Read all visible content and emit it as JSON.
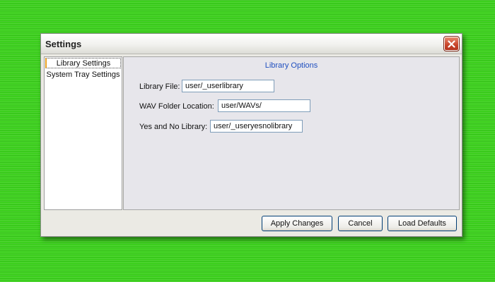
{
  "window": {
    "title": "Settings",
    "close_icon": "close-icon"
  },
  "sidebar": {
    "items": [
      {
        "label": "Library Settings",
        "selected": true
      },
      {
        "label": "System Tray Settings",
        "selected": false
      }
    ]
  },
  "main": {
    "section_title": "Library Options",
    "fields": [
      {
        "label": "Library File:",
        "value": "user/_userlibrary"
      },
      {
        "label": "WAV Folder Location:",
        "value": "user/WAVs/"
      },
      {
        "label": "Yes and No Library:",
        "value": "user/_useryesnolibrary"
      }
    ]
  },
  "buttons": {
    "apply": "Apply Changes",
    "cancel": "Cancel",
    "load_defaults": "Load Defaults"
  },
  "colors": {
    "background": "#3ccf1d",
    "accent": "#1f4fbf",
    "close_button": "#c8432a"
  }
}
